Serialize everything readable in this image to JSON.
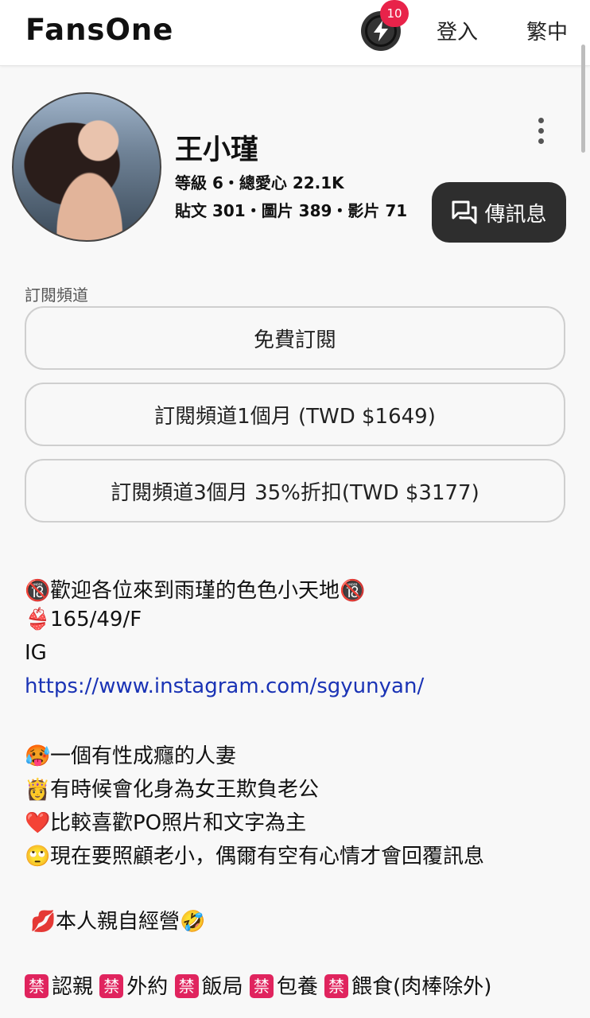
{
  "header": {
    "logo": "FansOne",
    "notification_count": "10",
    "login_label": "登入",
    "language_label": "繁中",
    "icon": "lightning-bolt-icon"
  },
  "profile": {
    "name": "王小瑾",
    "stats_line1": "等級 6・總愛心 22.1K",
    "stats_line2": "貼文 301・圖片 389・影片 71",
    "message_button": "傳訊息"
  },
  "subscribe": {
    "section_label": "訂閱頻道",
    "options": [
      "免費訂閱",
      "訂閱頻道1個月 (TWD $1649)",
      "訂閱頻道3個月 35%折扣(TWD $3177)"
    ]
  },
  "bio": {
    "welcome": "歡迎各位來到雨瑾的色色小天地",
    "stats": "165/49/F",
    "ig_label": "IG",
    "ig_link": "https://www.instagram.com/sgyunyan/",
    "line1": "一個有性成癮的人妻",
    "line2": "有時候會化身為女王欺負老公",
    "line3": "比較喜歡PO照片和文字為主",
    "line4": "現在要照顧老小，偶爾有空有心情才會回覆訊息",
    "line5": "本人親自經營",
    "ban_char": "禁",
    "ban_items": [
      "認親",
      "外約",
      "飯局",
      "包養",
      "餵食(肉棒除外)"
    ]
  }
}
